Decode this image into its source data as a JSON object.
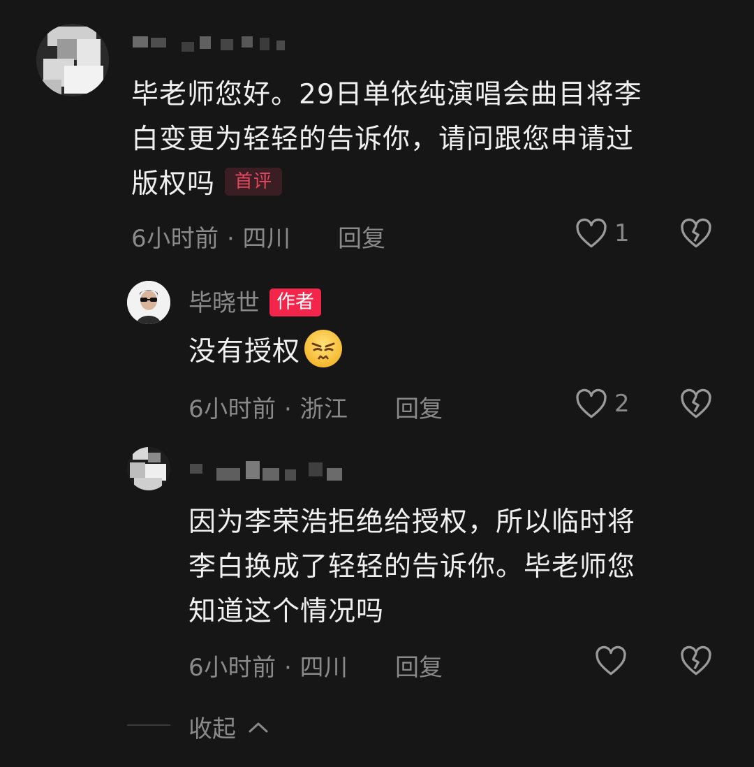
{
  "comments": [
    {
      "text_lines": [
        "毕老师您好。29日单依纯演唱会曲目将李",
        "白变更为轻轻的告诉你，请问跟您申请过",
        "版权吗"
      ],
      "badge": "首评",
      "meta": "6小时前 · 四川",
      "reply_label": "回复",
      "like_count": "1"
    },
    {
      "author": "毕晓世",
      "badge": "作者",
      "text": "没有授权",
      "emoji": "angry-face-emoji",
      "meta": "6小时前 · 浙江",
      "reply_label": "回复",
      "like_count": "2"
    },
    {
      "text_lines": [
        "因为李荣浩拒绝给授权，所以临时将",
        "李白换成了轻轻的告诉你。毕老师您",
        "知道这个情况吗"
      ],
      "meta": "6小时前 · 四川",
      "reply_label": "回复",
      "like_count": ""
    }
  ],
  "collapse_label": "收起",
  "icons": {
    "like": "heart-outline-icon",
    "dislike": "broken-heart-icon",
    "collapse": "chevron-up-icon"
  },
  "colors": {
    "background": "#161616",
    "text": "#f0f0f0",
    "muted": "#8a8a8a",
    "first_badge_text": "#e0485d",
    "author_badge_bg": "#f3254a"
  }
}
